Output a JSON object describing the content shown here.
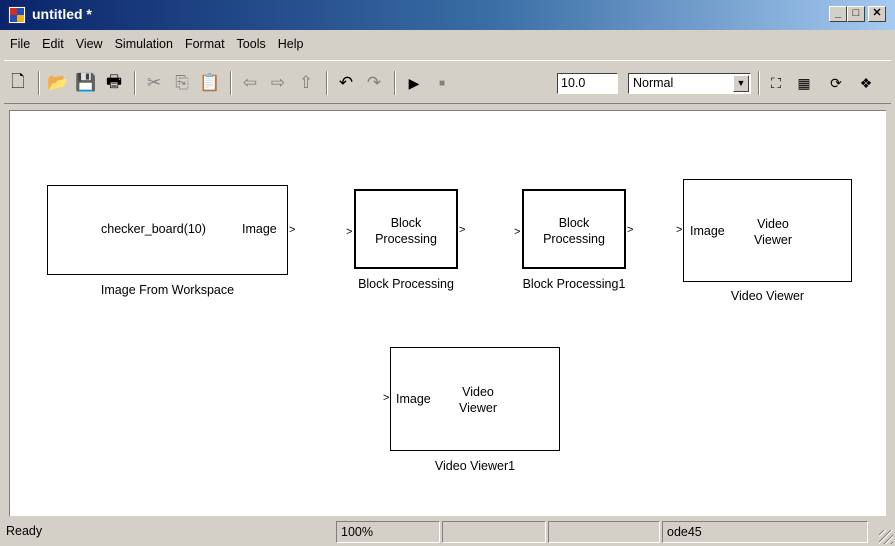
{
  "window": {
    "title": "untitled *",
    "minimize": "_",
    "maximize": "□",
    "close": "✕"
  },
  "menu": [
    "File",
    "Edit",
    "View",
    "Simulation",
    "Format",
    "Tools",
    "Help"
  ],
  "toolbar": {
    "icons": [
      "new-icon",
      "open-icon",
      "save-icon",
      "print-icon",
      "cut-icon",
      "copy-icon",
      "paste-icon",
      "back-icon",
      "forward-icon",
      "up-icon",
      "undo-icon",
      "redo-icon",
      "play-icon",
      "stop-icon"
    ],
    "stop_time": "10.0",
    "sim_mode": "Normal",
    "right_icons": [
      "build-icon",
      "model-explorer-icon",
      "library-browser-icon",
      "debugger-icon"
    ]
  },
  "blocks": {
    "image_from_workspace": {
      "content": "checker_board(10)",
      "out_port": "Image",
      "caption": "Image From Workspace"
    },
    "block_processing": {
      "line1": "Block",
      "line2": "Processing",
      "caption": "Block Processing"
    },
    "block_processing1": {
      "line1": "Block",
      "line2": "Processing",
      "caption": "Block Processing1"
    },
    "video_viewer": {
      "in_port": "Image",
      "line1": "Video",
      "line2": "Viewer",
      "caption": "Video Viewer"
    },
    "video_viewer1": {
      "in_port": "Image",
      "line1": "Video",
      "line2": "Viewer",
      "caption": "Video Viewer1"
    }
  },
  "status": {
    "state": "Ready",
    "zoom": "100%",
    "solver": "ode45"
  }
}
